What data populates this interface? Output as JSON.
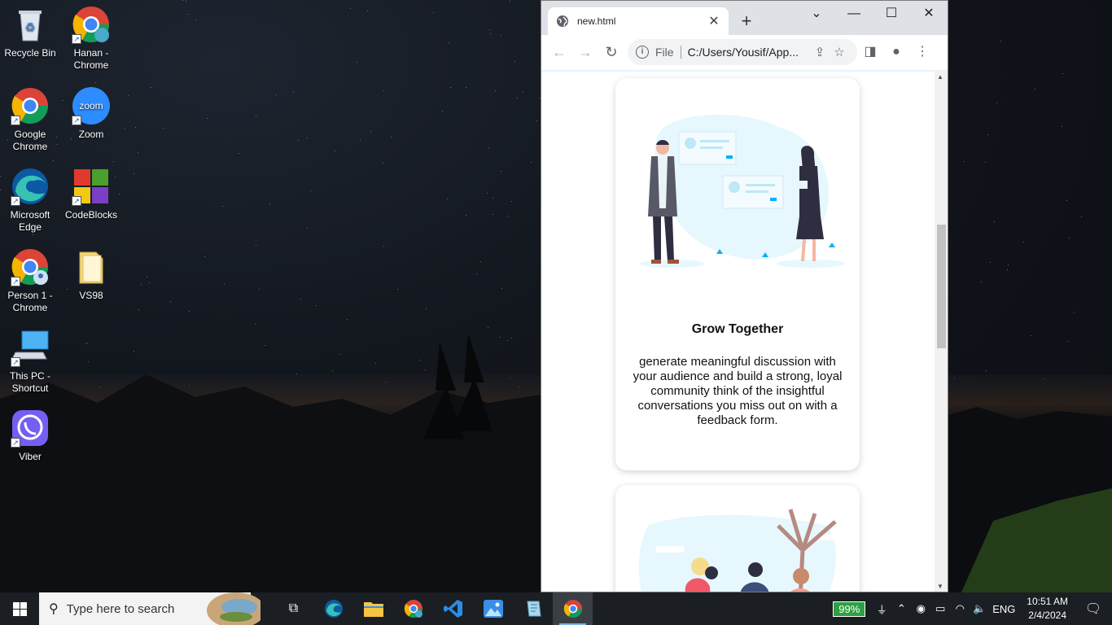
{
  "desktop": {
    "icons": [
      {
        "label": "Recycle Bin",
        "icon": "recycle-bin-icon"
      },
      {
        "label": "Hanan - Chrome",
        "icon": "chrome-profile-icon"
      },
      {
        "label": "Google Chrome",
        "icon": "chrome-icon"
      },
      {
        "label": "Zoom",
        "icon": "zoom-icon"
      },
      {
        "label": "Microsoft Edge",
        "icon": "edge-icon"
      },
      {
        "label": "CodeBlocks",
        "icon": "codeblocks-icon"
      },
      {
        "label": "Person 1 - Chrome",
        "icon": "chrome-profile-icon"
      },
      {
        "label": "VS98",
        "icon": "folder-icon"
      },
      {
        "label": "This PC - Shortcut",
        "icon": "computer-icon"
      },
      {
        "label": "Viber",
        "icon": "viber-icon"
      }
    ],
    "zoom_logo_text": "zoom"
  },
  "browser": {
    "tab_title": "new.html",
    "omnibox": {
      "scheme": "File",
      "url": "C:/Users/Yousif/App..."
    },
    "page": {
      "cards": [
        {
          "title": "Grow Together",
          "text": "generate meaningful discussion with your audience and build a strong, loyal community think of the insightful conversations you miss out on with a feedback form."
        }
      ]
    }
  },
  "taskbar": {
    "search_placeholder": "Type here to search",
    "battery": "99%",
    "language": "ENG",
    "time": "10:51 AM",
    "date": "2/4/2024"
  },
  "colors": {
    "illustration_accent": "#00b0ff",
    "illustration_bg": "#e6f7fd",
    "battery_green": "#2ea043"
  }
}
